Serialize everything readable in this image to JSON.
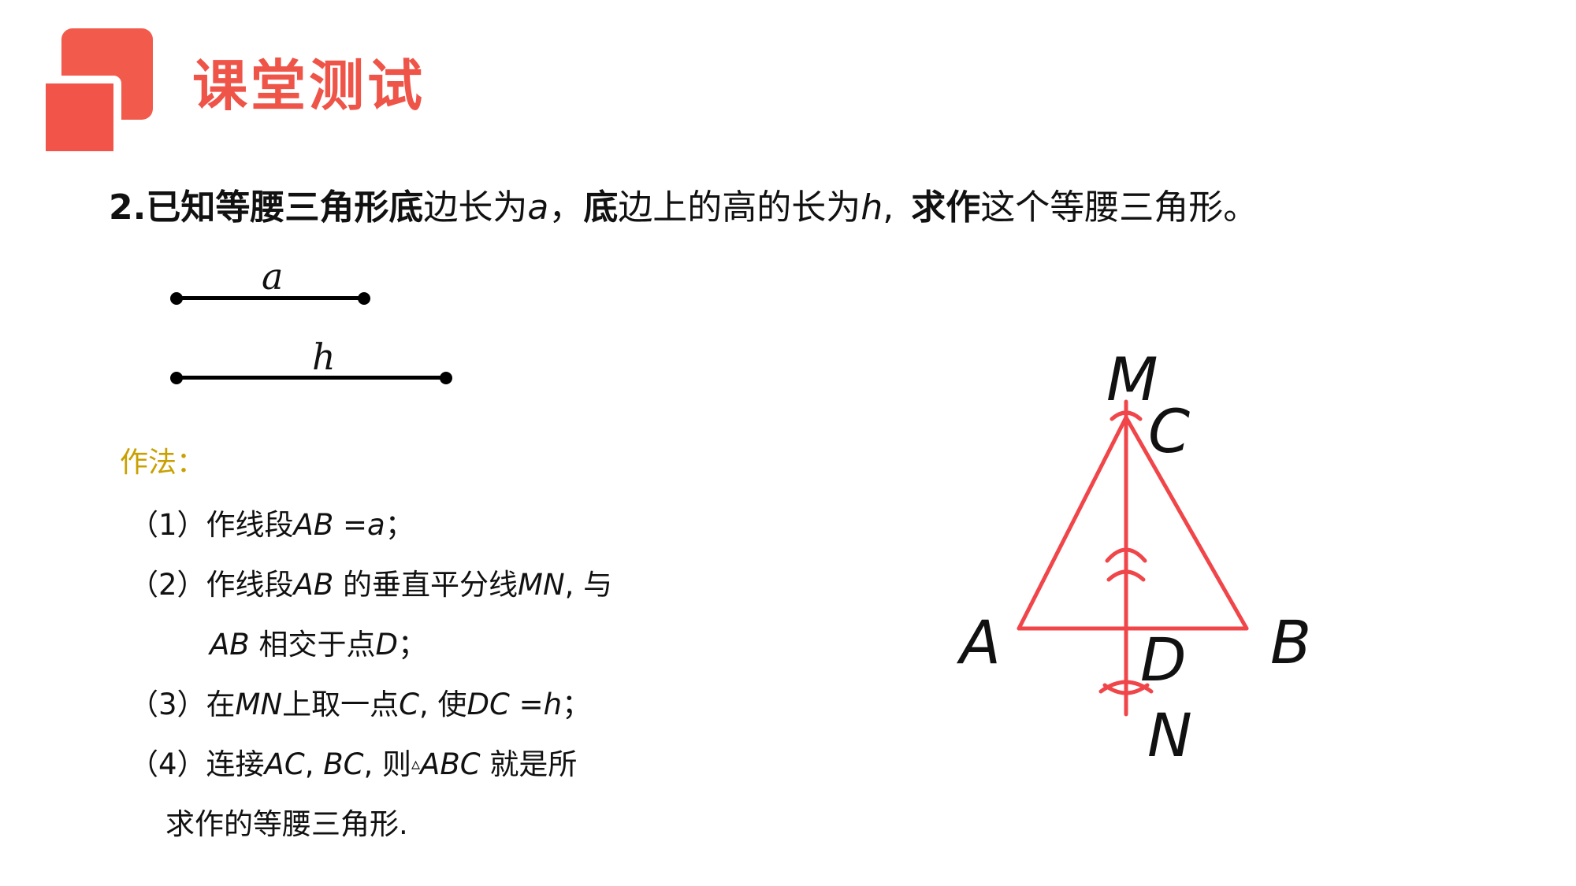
{
  "header": {
    "title": "课堂测试"
  },
  "question": {
    "number": "2.",
    "p1_bold": "已知等腰三角形底",
    "p2": "边长为",
    "var_a": "a",
    "p3": "，",
    "p4_bold": "底",
    "p5": "边上的高的长为",
    "var_h": "h",
    "p6": ",",
    "p7_bold": "求作",
    "p8": "这个等腰三角形",
    "p9": "。"
  },
  "segments": {
    "a_label": "a",
    "h_label": "h"
  },
  "method": {
    "title": "作法：",
    "step1": {
      "num": "（1）",
      "t1": "作线段",
      "v1": "AB",
      "t2": " =",
      "v2": "a",
      "t3": "；"
    },
    "step2": {
      "num": "（2）",
      "t1": "作线段",
      "v1": "AB",
      "t2": " 的垂直平分线",
      "v2": "MN",
      "t3": ",  与"
    },
    "step2b": {
      "v1": "AB",
      "t1": " 相交于点",
      "v2": "D",
      "t2": "；"
    },
    "step3": {
      "num": "（3）",
      "t1": "在",
      "v1": "MN",
      "t2": "上取一点",
      "v3": "C",
      "t3": ",  使",
      "v4": "DC",
      "t4": " =",
      "v5": "h",
      "t5": "；"
    },
    "step4": {
      "num": "（4）",
      "t1": "连接",
      "v1": "AC",
      "t2": ",   ",
      "v2": "BC",
      "t3": ",  则",
      "tri": "▵",
      "v3": "ABC",
      "t4": " 就是所"
    },
    "step4b": {
      "t1": "求作的等腰三角形."
    }
  },
  "figure": {
    "labels": {
      "M": "M",
      "C": "C",
      "A": "A",
      "B": "B",
      "D": "D",
      "N": "N"
    },
    "line_color": "#f0464a"
  }
}
